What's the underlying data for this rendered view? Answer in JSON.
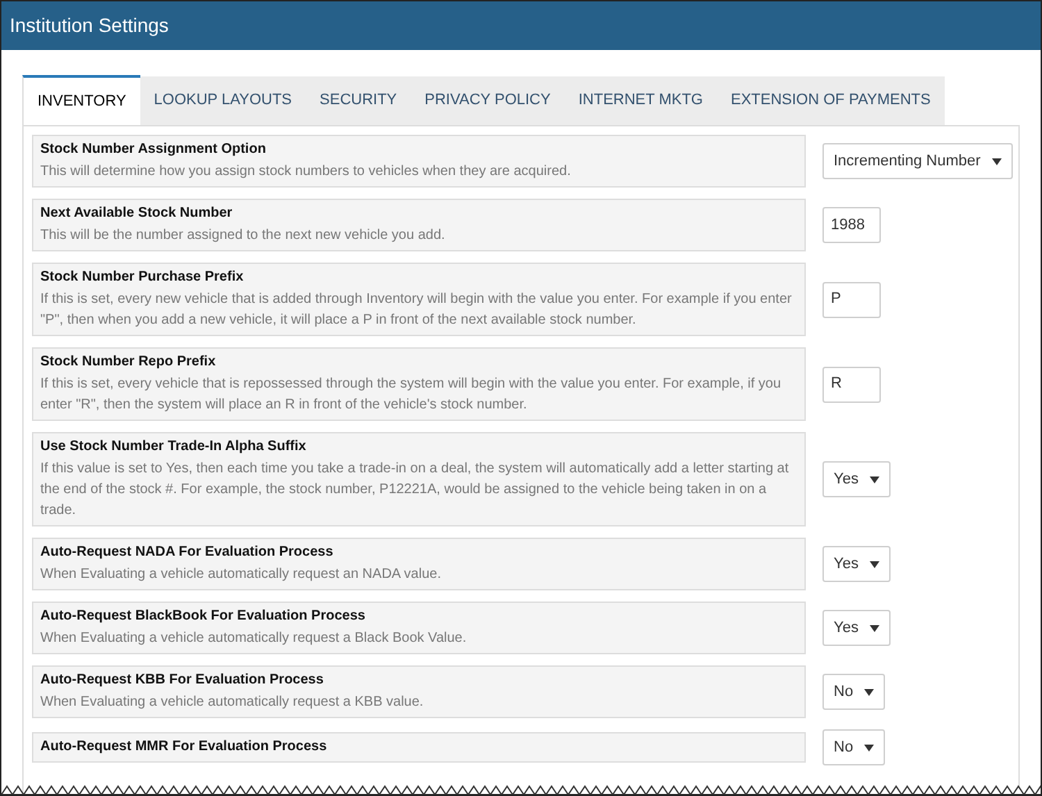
{
  "window": {
    "title": "Institution Settings"
  },
  "tabs": [
    {
      "label": "INVENTORY",
      "selected": true
    },
    {
      "label": "LOOKUP LAYOUTS",
      "selected": false
    },
    {
      "label": "SECURITY",
      "selected": false
    },
    {
      "label": "PRIVACY POLICY",
      "selected": false
    },
    {
      "label": "INTERNET MKTG",
      "selected": false
    },
    {
      "label": "EXTENSION OF PAYMENTS",
      "selected": false
    }
  ],
  "settings": [
    {
      "title": "Stock Number Assignment Option",
      "description": "This will determine how you assign stock numbers to vehicles when they are acquired.",
      "kind": "select",
      "value": "Incrementing Number"
    },
    {
      "title": "Next Available Stock Number",
      "description": "This will be the number assigned to the next new vehicle you add.",
      "kind": "input",
      "value": "1988"
    },
    {
      "title": "Stock Number Purchase Prefix",
      "description": "If this is set, every new vehicle that is added through Inventory will begin with the value you enter. For example if you enter \"P\", then when you add a new vehicle, it will place a P in front of the next available stock number.",
      "kind": "input",
      "value": "P"
    },
    {
      "title": "Stock Number Repo Prefix",
      "description": "If this is set, every vehicle that is repossessed through the system will begin with the value you enter. For example, if you enter \"R\", then the system will place an R in front of the vehicle's stock number.",
      "kind": "input",
      "value": "R"
    },
    {
      "title": "Use Stock Number Trade-In Alpha Suffix",
      "description": "If this value is set to Yes, then each time you take a trade-in on a deal, the system will automatically add a letter starting at the end of the stock #. For example, the stock number, P12221A, would be assigned to the vehicle being taken in on a trade.",
      "kind": "select",
      "value": "Yes"
    },
    {
      "title": "Auto-Request NADA For Evaluation Process",
      "description": "When Evaluating a vehicle automatically request an NADA value.",
      "kind": "select",
      "value": "Yes"
    },
    {
      "title": "Auto-Request BlackBook For Evaluation Process",
      "description": "When Evaluating a vehicle automatically request a Black Book Value.",
      "kind": "select",
      "value": "Yes"
    },
    {
      "title": "Auto-Request KBB For Evaluation Process",
      "description": "When Evaluating a vehicle automatically request a KBB value.",
      "kind": "select",
      "value": "No"
    },
    {
      "title": "Auto-Request MMR For Evaluation Process",
      "kind": "select",
      "value": "No"
    }
  ]
}
